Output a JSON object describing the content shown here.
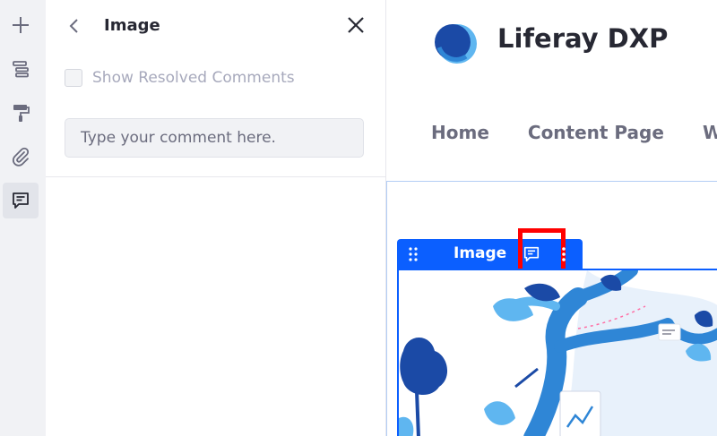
{
  "sidebar": {
    "items": [
      {
        "name": "add",
        "icon": "plus-icon"
      },
      {
        "name": "browser",
        "icon": "page-structure-icon"
      },
      {
        "name": "look-and-feel",
        "icon": "paint-roller-icon"
      },
      {
        "name": "mappings",
        "icon": "paperclip-icon"
      },
      {
        "name": "comments",
        "icon": "comments-icon",
        "active": true
      }
    ]
  },
  "panel": {
    "title": "Image",
    "show_resolved_label": "Show Resolved Comments",
    "comment_placeholder": "Type your comment here."
  },
  "page": {
    "site_name": "Liferay DXP",
    "nav": [
      "Home",
      "Content Page",
      "W"
    ]
  },
  "fragment": {
    "topper_label": "Image"
  },
  "colors": {
    "accent": "#0b5fff",
    "highlight": "#ff0000",
    "illustration_dark": "#1b4aa6",
    "illustration_mid": "#2f86d6",
    "illustration_light": "#5fb6f0"
  }
}
